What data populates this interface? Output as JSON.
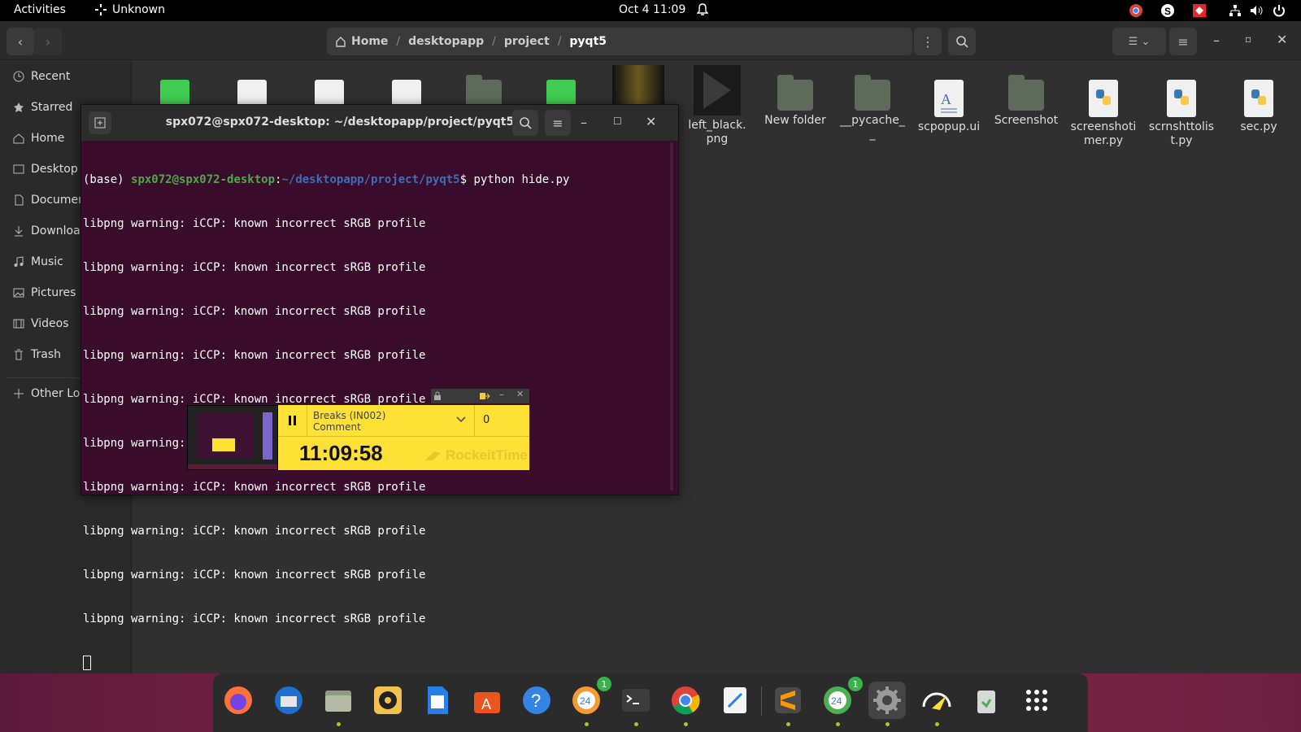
{
  "topbar": {
    "activities": "Activities",
    "app_name": "Unknown",
    "clock": "Oct 4  11:09"
  },
  "files_header": {
    "breadcrumbs": [
      "Home",
      "desktopapp",
      "project",
      "pyqt5"
    ]
  },
  "sidebar": {
    "items": [
      {
        "label": "Recent",
        "icon": "clock-icon"
      },
      {
        "label": "Starred",
        "icon": "star-icon"
      },
      {
        "label": "Home",
        "icon": "home-icon"
      },
      {
        "label": "Desktop",
        "icon": "desktop-icon"
      },
      {
        "label": "Documents",
        "icon": "document-icon"
      },
      {
        "label": "Downloads",
        "icon": "download-icon"
      },
      {
        "label": "Music",
        "icon": "music-icon"
      },
      {
        "label": "Pictures",
        "icon": "picture-icon"
      },
      {
        "label": "Videos",
        "icon": "video-icon"
      },
      {
        "label": "Trash",
        "icon": "trash-icon"
      },
      {
        "label": "Other Locations",
        "icon": "plus-icon"
      }
    ]
  },
  "files": {
    "visible": [
      {
        "name": "left_black.\npng",
        "type": "image"
      },
      {
        "name": "New folder",
        "type": "folder"
      },
      {
        "name": "__pycache_\n_",
        "type": "folder"
      },
      {
        "name": "scpopup.ui",
        "type": "doc"
      },
      {
        "name": "Screenshot",
        "type": "folder"
      },
      {
        "name": "screenshoti\nmer.py",
        "type": "python"
      },
      {
        "name": "scrnshttolis\nt.py",
        "type": "python"
      },
      {
        "name": "sec.py",
        "type": "python"
      }
    ]
  },
  "terminal": {
    "title": "spx072@spx072-desktop: ~/desktopapp/project/pyqt5",
    "prompt_env": "(base) ",
    "prompt_user": "spx072@spx072-desktop",
    "prompt_colon": ":",
    "prompt_path": "~/desktopapp/project/pyqt5",
    "prompt_cmd": "$ python hide.py",
    "output_lines": [
      "libpng warning: iCCP: known incorrect sRGB profile",
      "libpng warning: iCCP: known incorrect sRGB profile",
      "libpng warning: iCCP: known incorrect sRGB profile",
      "libpng warning: iCCP: known incorrect sRGB profile",
      "libpng warning: iCCP: known incorrect sRGB profile",
      "libpng warning: iCCP: known incorrect sRGB profile",
      "libpng warning: iCCP: known incorrect sRGB profile",
      "libpng warning: iCCP: known incorrect sRGB profile",
      "libpng warning: iCCP: known incorrect sRGB profile",
      "libpng warning: iCCP: known incorrect sRGB profile"
    ]
  },
  "rockeit": {
    "task": "Breaks (IN002)",
    "comment": "Comment",
    "count": "0",
    "timer": "11:09:58",
    "brand": "RockeitTime",
    "accent": "#ffe135"
  },
  "dock": {
    "apps": [
      {
        "name": "firefox-icon"
      },
      {
        "name": "thunderbird-icon"
      },
      {
        "name": "files-icon"
      },
      {
        "name": "rhythmbox-icon"
      },
      {
        "name": "writer-icon"
      },
      {
        "name": "software-icon"
      },
      {
        "name": "help-icon"
      },
      {
        "name": "chat-app-icon",
        "badge": "1"
      },
      {
        "name": "terminal-icon"
      },
      {
        "name": "chrome-icon"
      },
      {
        "name": "text-editor-icon"
      },
      {
        "name": "sublime-icon"
      },
      {
        "name": "chat-app-2-icon",
        "badge": "1"
      },
      {
        "name": "settings-icon"
      },
      {
        "name": "rockeit-icon"
      },
      {
        "name": "trash-icon"
      },
      {
        "name": "app-grid-icon"
      }
    ]
  }
}
